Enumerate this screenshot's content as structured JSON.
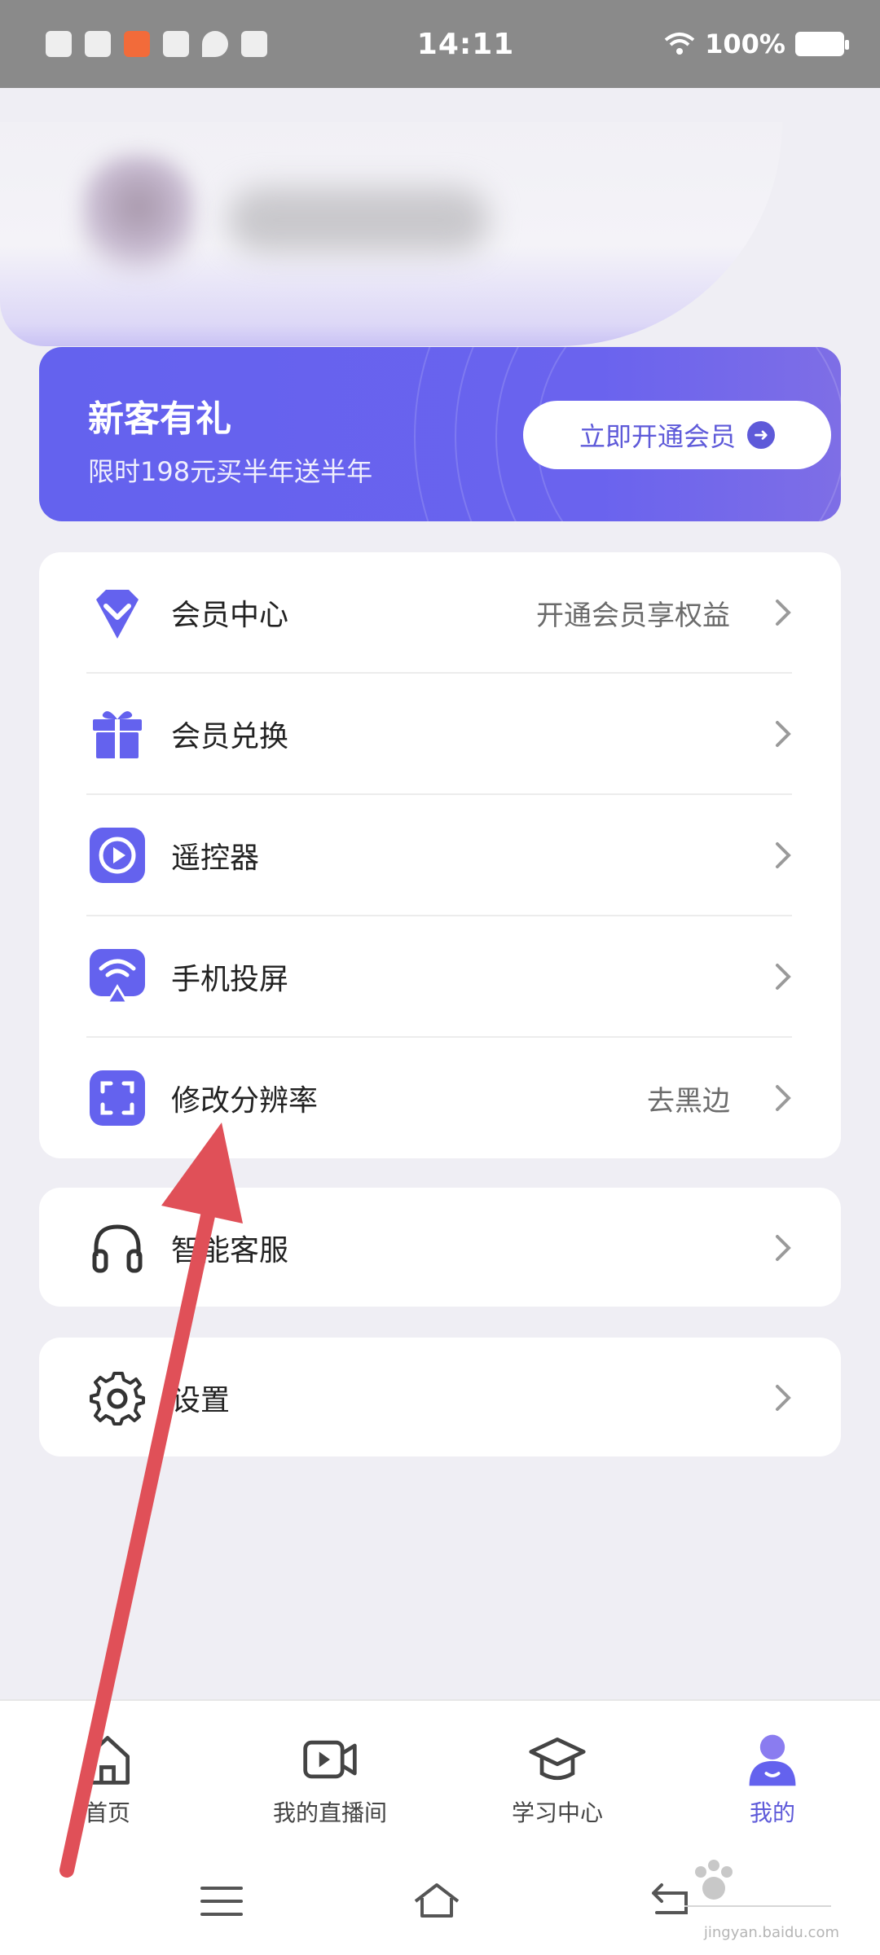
{
  "status_bar": {
    "time": "14:11",
    "battery": "100%",
    "icons": [
      "sim-icon",
      "cloud-icon",
      "app-icon",
      "du-icon",
      "location-icon",
      "qr-icon",
      "wifi-icon",
      "battery-icon"
    ]
  },
  "promo": {
    "title": "新客有礼",
    "subtitle": "限时198元买半年送半年",
    "button_label": "立即开通会员",
    "accent_color": "#6462ee"
  },
  "menu": {
    "items": [
      {
        "label": "会员中心",
        "hint": "开通会员享权益",
        "icon": "diamond-icon"
      },
      {
        "label": "会员兑换",
        "hint": "",
        "icon": "gift-icon"
      },
      {
        "label": "遥控器",
        "hint": "",
        "icon": "play-icon"
      },
      {
        "label": "手机投屏",
        "hint": "",
        "icon": "cast-icon"
      },
      {
        "label": "修改分辨率",
        "hint": "去黑边",
        "icon": "resolution-icon"
      }
    ]
  },
  "service": {
    "label": "智能客服",
    "icon": "headset-icon"
  },
  "settings": {
    "label": "设置",
    "icon": "gear-icon"
  },
  "bottom_nav": {
    "items": [
      {
        "label": "首页",
        "icon": "home-icon",
        "active": false
      },
      {
        "label": "我的直播间",
        "icon": "video-icon",
        "active": false
      },
      {
        "label": "学习中心",
        "icon": "graduation-cap-icon",
        "active": false
      },
      {
        "label": "我的",
        "icon": "user-icon",
        "active": true
      }
    ]
  },
  "watermark": {
    "text": "jingyan.baidu.com"
  }
}
